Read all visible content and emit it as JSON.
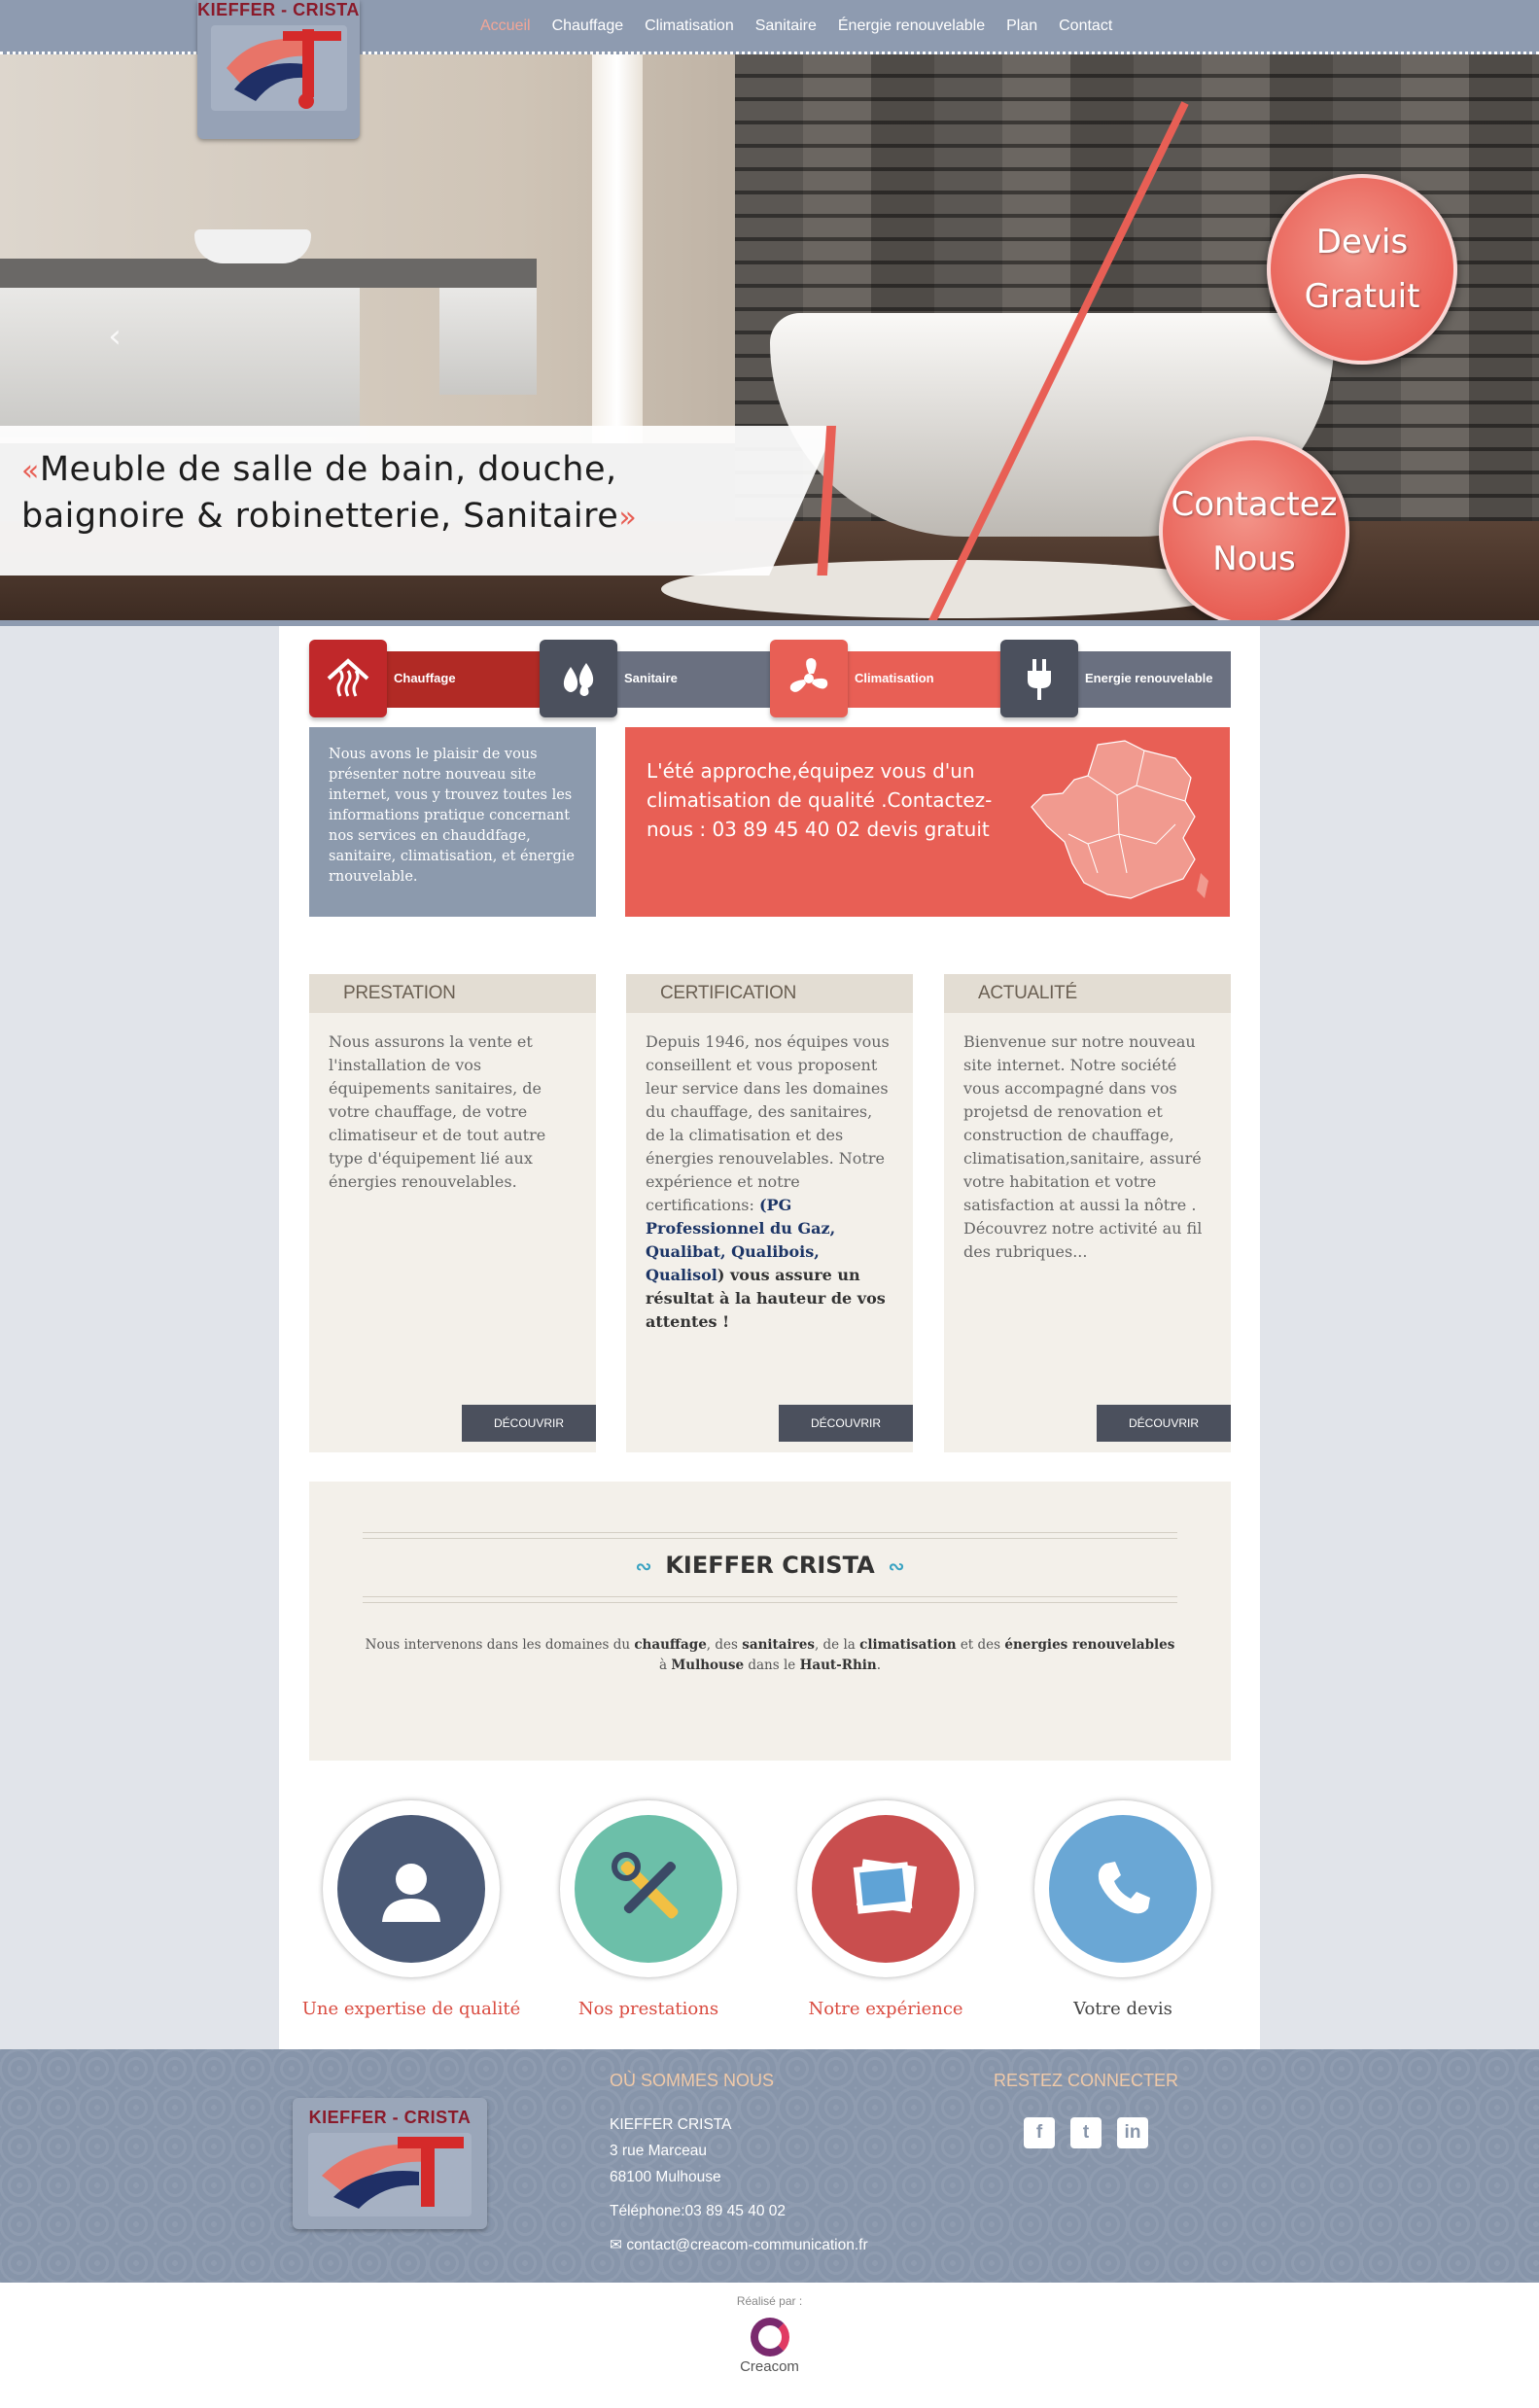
{
  "brand": {
    "name": "KIEFFER - CRISTA"
  },
  "nav": {
    "items": [
      "Accueil",
      "Chauffage",
      "Climatisation",
      "Sanitaire",
      "Énergie renouvelable",
      "Plan",
      "Contact"
    ],
    "active": "Accueil"
  },
  "hero": {
    "line1": "Meuble de salle de bain, douche,",
    "line2": "baignoire & robinetterie, Sanitaire",
    "quote_open": "«",
    "quote_close": "»",
    "prev_icon": "chevron-left-icon",
    "next_icon": "chevron-right-icon",
    "devis": {
      "line1": "Devis",
      "line2": "Gratuit"
    },
    "contact": {
      "line1": "Contactez",
      "line2": "Nous"
    }
  },
  "tabs": [
    {
      "label": "Chauffage",
      "icon": "house-heat-icon",
      "color": "#c0282a",
      "bar": "#b12a25"
    },
    {
      "label": "Sanitaire",
      "icon": "drops-icon",
      "color": "#4b505d",
      "bar": "#6a7080"
    },
    {
      "label": "Climatisation",
      "icon": "fan-icon",
      "color": "#e85f55",
      "bar": "#e85f55"
    },
    {
      "label": "Energie renouvelable",
      "icon": "plug-icon",
      "color": "#4b505d",
      "bar": "#6a7080"
    }
  ],
  "intro": "Nous avons le plaisir de vous présenter notre nouveau site internet, vous y trouvez toutes les informations pratique concernant nos services en chauddfage, sanitaire, climatisation, et énergie rnouvelable.",
  "promo": "L'été approche,équipez vous d'un climatisation de qualité .Contactez-nous : 03 89 45 40 02 devis gratuit",
  "columns": {
    "prestation": {
      "title": "PRESTATION",
      "text": "Nous assurons la vente et l'installation de vos équipements sanitaires, de votre chauffage, de votre climatiseur et de tout autre type d'équipement lié aux énergies renouvelables.",
      "button": "DÉCOUVRIR"
    },
    "certification": {
      "title": "CERTIFICATION",
      "text1": "Depuis 1946, nos équipes vous conseillent et vous proposent leur service dans les domaines du chauffage, des sanitaires, de la climatisation et des énergies renouvelables. Notre expérience  et notre certifications: ",
      "open_paren": "(",
      "blue": "PG Professionnel du Gaz, Qualibat, Qualibois, Qualisol",
      "text2": ") vous assure un résultat à la hauteur de vos attentes !",
      "button": "DÉCOUVRIR"
    },
    "actualite": {
      "title": "ACTUALITÉ",
      "text": "Bienvenue sur notre nouveau site internet. Notre société vous accompagné dans vos projetsd de renovation et construction de chauffage, climatisation,sanitaire, assuré votre habitation et votre satisfaction at aussi la nôtre . Découvrez notre activité au fil des rubriques...",
      "button": "DÉCOUVRIR"
    }
  },
  "about": {
    "title": "KIEFFER CRISTA",
    "t1": "Nous intervenons dans les domaines du ",
    "b1": "chauffage",
    "t2": ", des ",
    "b2": "sanitaires",
    "t3": ", de la ",
    "b3": "climatisation",
    "t4": " et des ",
    "b4": "énergies renouvelables",
    "t5": " à ",
    "b5": "Mulhouse",
    "t6": " dans le ",
    "b6": "Haut-Rhin",
    "t7": "."
  },
  "features": [
    {
      "label": "Une expertise de qualité",
      "icon": "user-icon",
      "color": "#4b5a76"
    },
    {
      "label": "Nos prestations",
      "icon": "tools-icon",
      "color": "#6cbfa9"
    },
    {
      "label": "Notre expérience",
      "icon": "photos-icon",
      "color": "#c94e4e"
    },
    {
      "label": "Votre devis",
      "icon": "phone-icon",
      "color": "#6aa7d5"
    }
  ],
  "footer": {
    "where_title": "OÙ SOMMES NOUS",
    "company": "KIEFFER CRISTA",
    "street": "3 rue Marceau",
    "city": "68100 Mulhouse",
    "phone": "Téléphone:03 89 45 40 02",
    "email": "contact@creacom-communication.fr",
    "social_title": "RESTEZ CONNECTER",
    "social": [
      {
        "icon": "facebook-icon",
        "glyph": "f"
      },
      {
        "icon": "twitter-icon",
        "glyph": "t"
      },
      {
        "icon": "linkedin-icon",
        "glyph": "in"
      }
    ]
  },
  "credit": {
    "label": "Réalisé par :",
    "name": "Creacom"
  }
}
